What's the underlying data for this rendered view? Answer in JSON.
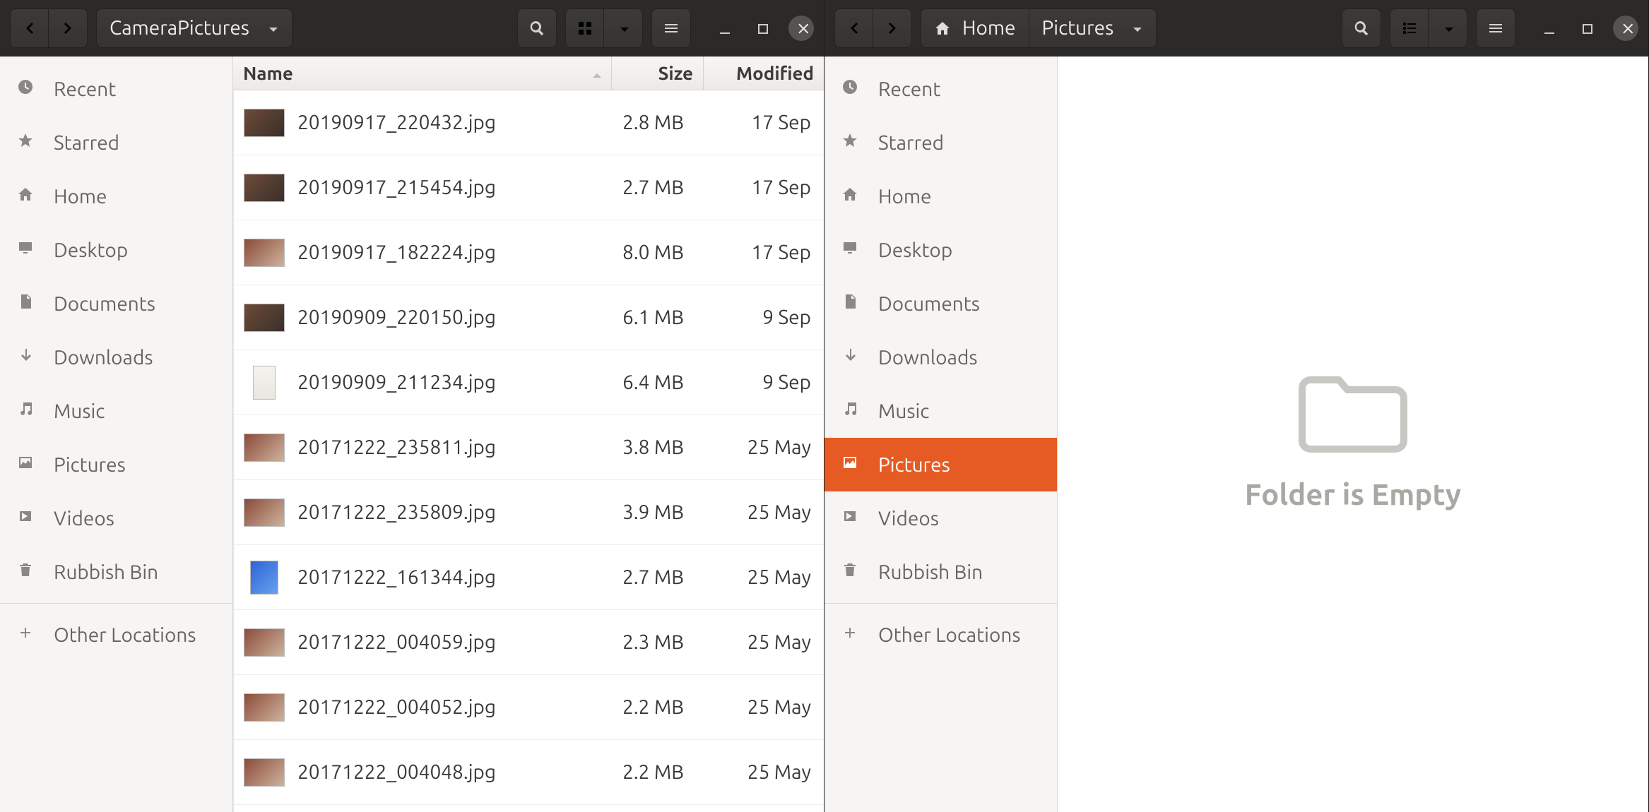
{
  "left": {
    "path_label": "CameraPictures",
    "columns": {
      "name": "Name",
      "size": "Size",
      "modified": "Modified"
    },
    "sidebar": {
      "recent": "Recent",
      "starred": "Starred",
      "home": "Home",
      "desktop": "Desktop",
      "documents": "Documents",
      "downloads": "Downloads",
      "music": "Music",
      "pictures": "Pictures",
      "videos": "Videos",
      "trash": "Rubbish Bin",
      "other": "Other Locations"
    },
    "files": [
      {
        "name": "20190917_220432.jpg",
        "size": "2.8 MB",
        "mod": "17 Sep",
        "thumb": "dark"
      },
      {
        "name": "20190917_215454.jpg",
        "size": "2.7 MB",
        "mod": "17 Sep",
        "thumb": "dark"
      },
      {
        "name": "20190917_182224.jpg",
        "size": "8.0 MB",
        "mod": "17 Sep",
        "thumb": "people"
      },
      {
        "name": "20190909_220150.jpg",
        "size": "6.1 MB",
        "mod": "9 Sep",
        "thumb": "dark"
      },
      {
        "name": "20190909_211234.jpg",
        "size": "6.4 MB",
        "mod": "9 Sep",
        "thumb": "portrait"
      },
      {
        "name": "20171222_235811.jpg",
        "size": "3.8 MB",
        "mod": "25 May",
        "thumb": "people"
      },
      {
        "name": "20171222_235809.jpg",
        "size": "3.9 MB",
        "mod": "25 May",
        "thumb": "people"
      },
      {
        "name": "20171222_161344.jpg",
        "size": "2.7 MB",
        "mod": "25 May",
        "thumb": "blue"
      },
      {
        "name": "20171222_004059.jpg",
        "size": "2.3 MB",
        "mod": "25 May",
        "thumb": "people"
      },
      {
        "name": "20171222_004052.jpg",
        "size": "2.2 MB",
        "mod": "25 May",
        "thumb": "people"
      },
      {
        "name": "20171222_004048.jpg",
        "size": "2.2 MB",
        "mod": "25 May",
        "thumb": "people"
      }
    ]
  },
  "right": {
    "path_home": "Home",
    "path_current": "Pictures",
    "empty_text": "Folder is Empty",
    "sidebar": {
      "recent": "Recent",
      "starred": "Starred",
      "home": "Home",
      "desktop": "Desktop",
      "documents": "Documents",
      "downloads": "Downloads",
      "music": "Music",
      "pictures": "Pictures",
      "videos": "Videos",
      "trash": "Rubbish Bin",
      "other": "Other Locations"
    }
  }
}
